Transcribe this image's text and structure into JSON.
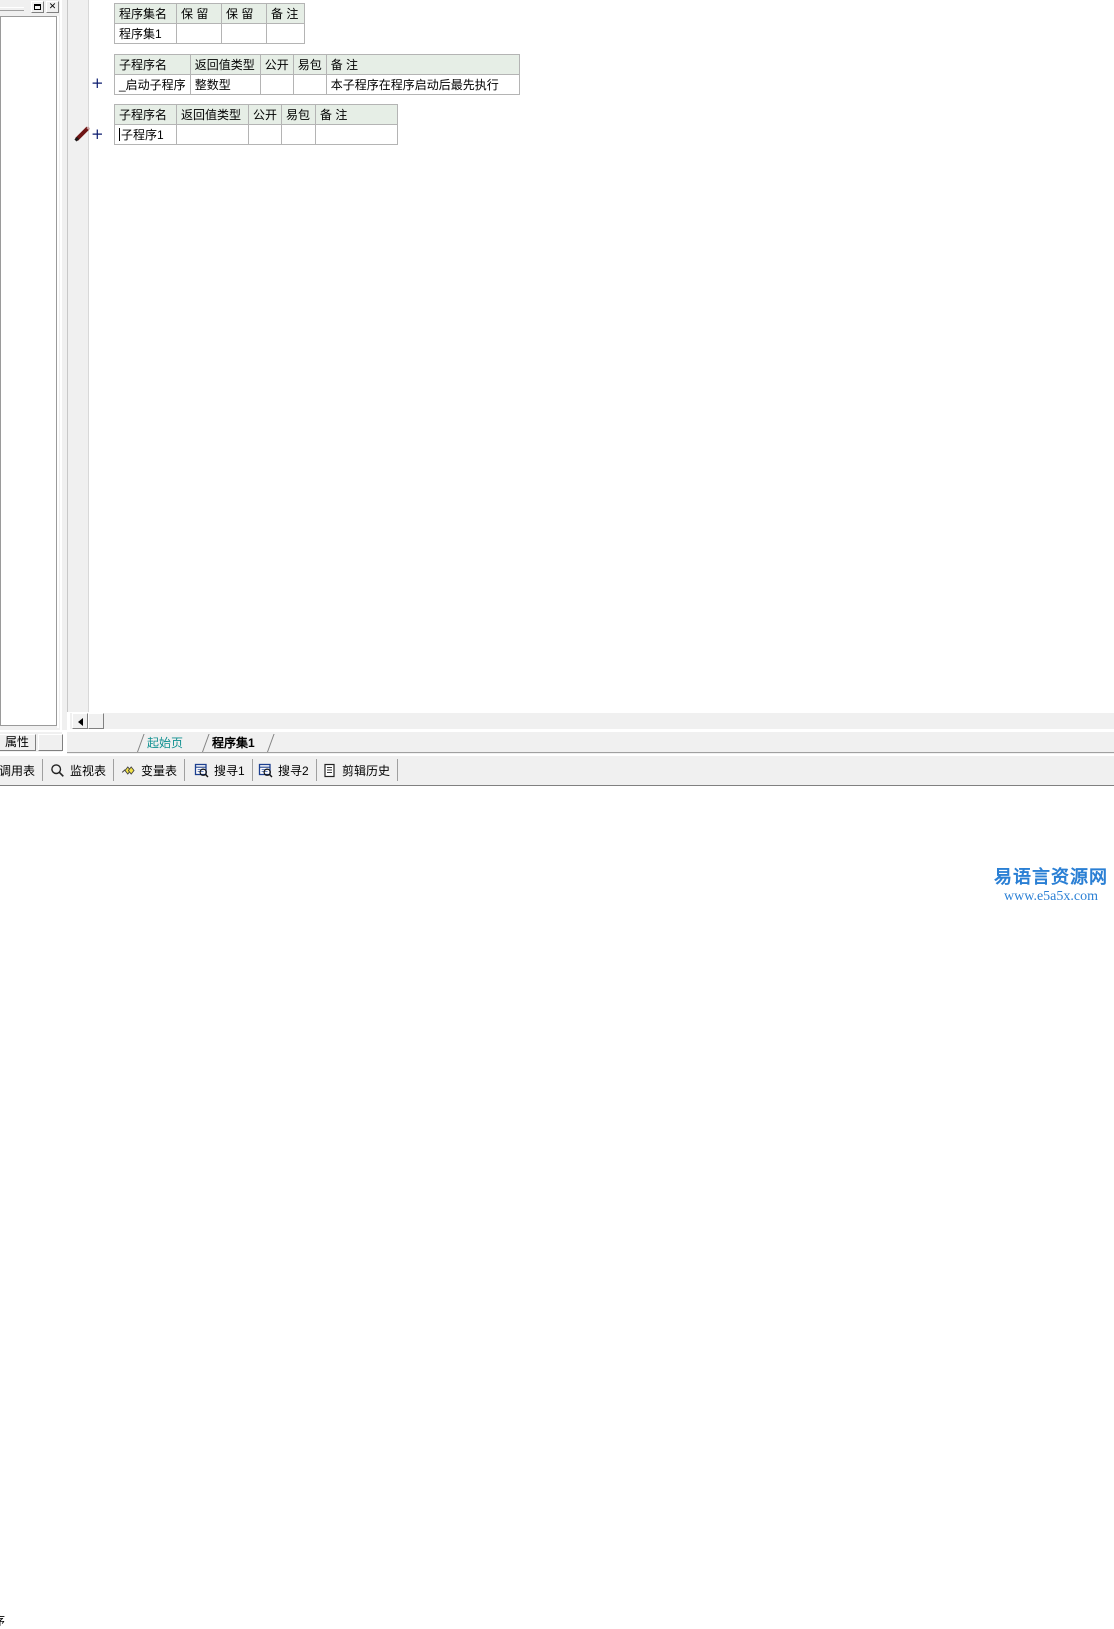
{
  "window_controls": {
    "maximize_label": "□",
    "close_label": "✕"
  },
  "left_panel": {
    "tab_label": "属性"
  },
  "editor": {
    "assembly_table": {
      "headers": [
        "程序集名",
        "保 留",
        "保 留",
        "备 注"
      ],
      "rows": [
        [
          "程序集1",
          "",
          "",
          ""
        ]
      ]
    },
    "start_sub_table": {
      "headers": [
        "子程序名",
        "返回值类型",
        "公开",
        "易包",
        "备 注"
      ],
      "rows": [
        [
          "_启动子程序",
          "整数型",
          "",
          "",
          "本子程序在程序启动后最先执行"
        ]
      ],
      "expander": "+"
    },
    "sub1_table": {
      "headers": [
        "子程序名",
        "返回值类型",
        "公开",
        "易包",
        "备 注"
      ],
      "rows": [
        [
          "子程序1",
          "",
          "",
          "",
          ""
        ]
      ],
      "expander": "+"
    },
    "colors": {
      "header_bg": "#e6eee6",
      "type_text": "#0000c8",
      "comment_text": "#008000",
      "expander": "#0a1a6e",
      "pencil": "#6e1414"
    }
  },
  "scrollbar": {
    "left_arrow": "◀"
  },
  "doc_tabs": [
    {
      "label": "起始页",
      "active": false
    },
    {
      "label": "程序集1",
      "active": true
    }
  ],
  "bottom_bar": {
    "items": [
      {
        "label": "调用表",
        "icon": "none"
      },
      {
        "label": "监视表",
        "icon": "magnifier-icon"
      },
      {
        "label": "变量表",
        "icon": "diamonds-icon"
      },
      {
        "label": "搜寻1",
        "icon": "find-window-icon"
      },
      {
        "label": "搜寻2",
        "icon": "find-window-icon"
      },
      {
        "label": "剪辑历史",
        "icon": "clipboard-icon"
      }
    ]
  },
  "output_pane": {
    "text": "序"
  },
  "watermark": {
    "cn": "易语言资源网",
    "url": "www.e5a5x.com",
    "color": "#2a7fd4"
  }
}
